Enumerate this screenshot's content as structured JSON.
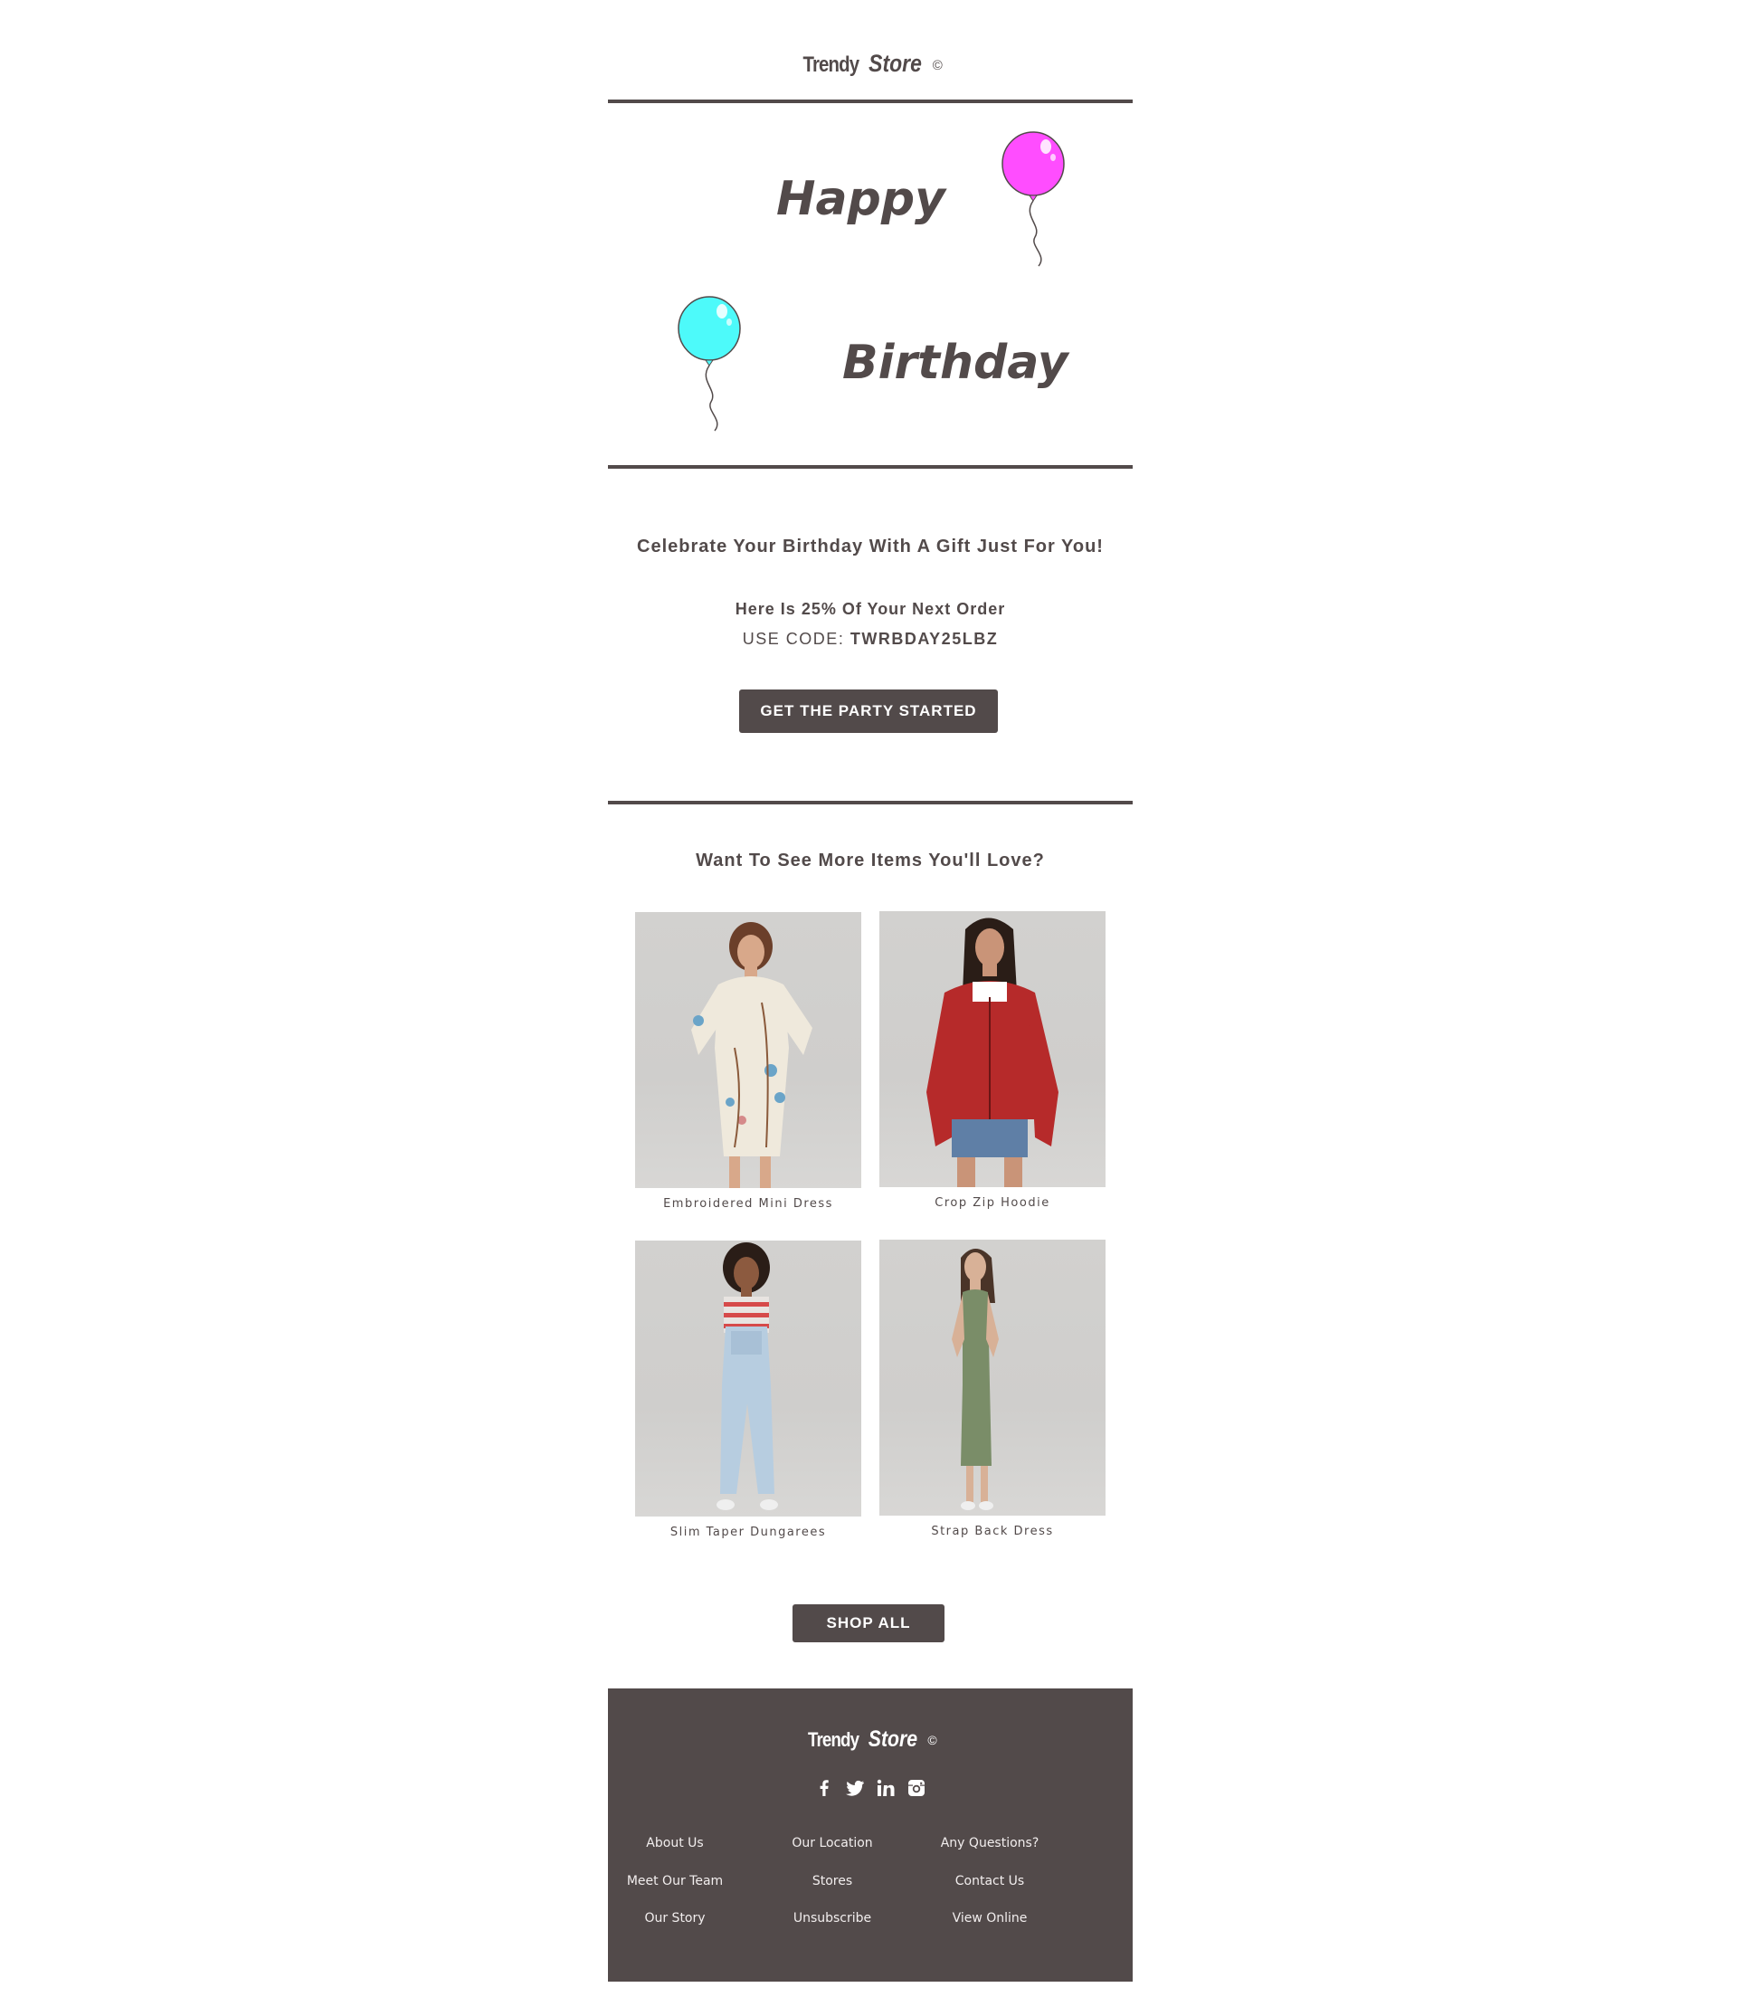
{
  "brand": {
    "name_part1": "Trendy",
    "name_part2": "Store",
    "mark": "©"
  },
  "hero": {
    "line1": "Happy",
    "line2": "Birthday",
    "balloon_colors": [
      "#ff4dff",
      "#4dfafa"
    ]
  },
  "offer": {
    "title": "Celebrate Your Birthday With A Gift Just For You!",
    "discount_line": "Here Is 25% Of Your Next Order",
    "code_prefix": "USE CODE:",
    "code": "TWRBDAY25LBZ",
    "button_label": "GET THE PARTY STARTED"
  },
  "recommendations": {
    "title": "Want To See More Items You'll Love?",
    "products": [
      {
        "name": "Embroidered Mini Dress"
      },
      {
        "name": "Crop Zip Hoodie"
      },
      {
        "name": "Slim Taper Dungarees"
      },
      {
        "name": "Strap Back Dress"
      }
    ],
    "shop_all_label": "SHOP ALL"
  },
  "footer": {
    "social_icons": [
      "facebook-icon",
      "twitter-icon",
      "linkedin-icon",
      "instagram-icon"
    ],
    "links": [
      [
        "About Us",
        "Our Location",
        "Any Questions?"
      ],
      [
        "Meet Our Team",
        "Stores",
        "Contact Us"
      ],
      [
        "Our Story",
        "Unsubscribe",
        "View Online"
      ]
    ]
  },
  "colors": {
    "primary": "#524a4a",
    "background": "#ffffff",
    "footer_text": "#f2eeee"
  }
}
